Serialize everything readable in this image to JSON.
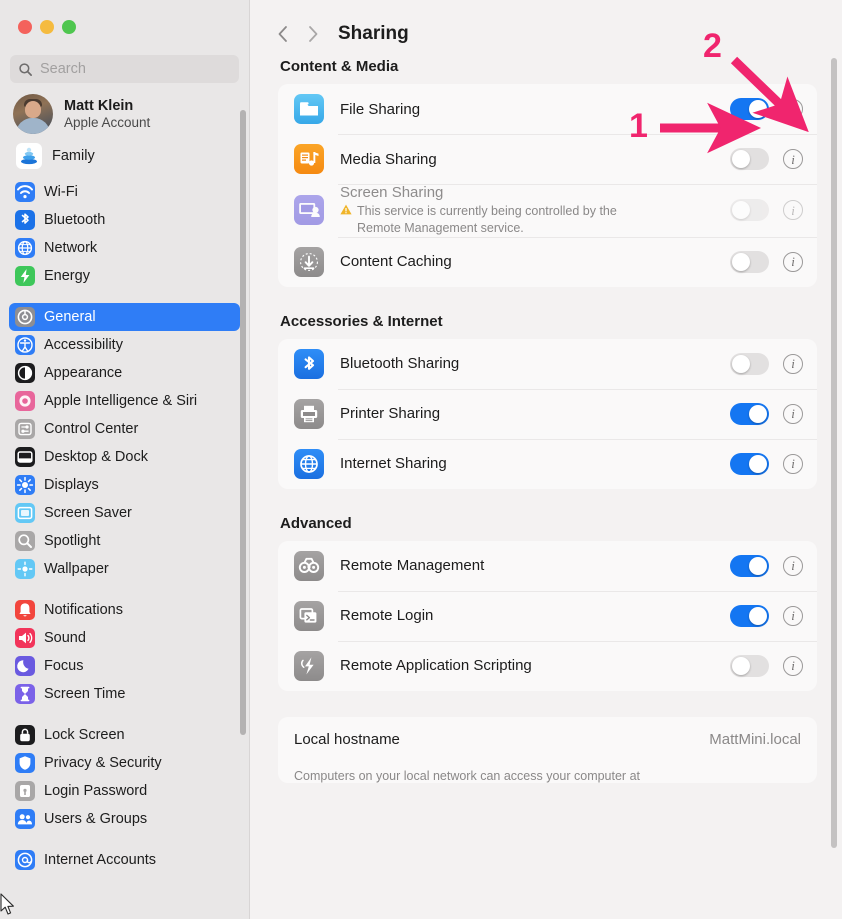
{
  "window": {
    "traffic_lights": [
      "close",
      "minimize",
      "zoom"
    ],
    "colors": {
      "close": "#f4625c",
      "minimize": "#f5bb3f",
      "zoom": "#4fc64f"
    }
  },
  "sidebar": {
    "search": {
      "placeholder": "Search",
      "value": "",
      "icon": "search-icon"
    },
    "account": {
      "name": "Matt Klein",
      "subtitle": "Apple Account",
      "avatar": "user-avatar"
    },
    "family": {
      "label": "Family",
      "icon": "family-icon"
    },
    "groups": [
      {
        "items": [
          {
            "label": "Wi-Fi",
            "icon": "wifi-icon",
            "color": "#2f7df6",
            "selected": false
          },
          {
            "label": "Bluetooth",
            "icon": "bluetooth-icon",
            "color": "#1b72e8",
            "selected": false
          },
          {
            "label": "Network",
            "icon": "network-icon",
            "color": "#2f7df6",
            "selected": false
          },
          {
            "label": "Energy",
            "icon": "energy-icon",
            "color": "#3ec75a",
            "selected": false
          }
        ]
      },
      {
        "items": [
          {
            "label": "General",
            "icon": "gear-icon",
            "color": "#8e8e93",
            "selected": true
          },
          {
            "label": "Accessibility",
            "icon": "accessibility-icon",
            "color": "#2f7df6",
            "selected": false
          },
          {
            "label": "Appearance",
            "icon": "appearance-icon",
            "color": "#1c1c1e",
            "selected": false
          },
          {
            "label": "Apple Intelligence & Siri",
            "icon": "siri-icon",
            "color": "#e8669b",
            "selected": false
          },
          {
            "label": "Control Center",
            "icon": "control-center-icon",
            "color": "#a9a7a7",
            "selected": false
          },
          {
            "label": "Desktop & Dock",
            "icon": "desktop-dock-icon",
            "color": "#1c1c1e",
            "selected": false
          },
          {
            "label": "Displays",
            "icon": "displays-icon",
            "color": "#2f7df6",
            "selected": false
          },
          {
            "label": "Screen Saver",
            "icon": "screen-saver-icon",
            "color": "#63c8f5",
            "selected": false
          },
          {
            "label": "Spotlight",
            "icon": "spotlight-icon",
            "color": "#a9a7a7",
            "selected": false
          },
          {
            "label": "Wallpaper",
            "icon": "wallpaper-icon",
            "color": "#63c8f5",
            "selected": false
          }
        ]
      },
      {
        "items": [
          {
            "label": "Notifications",
            "icon": "notifications-icon",
            "color": "#f2453d",
            "selected": false
          },
          {
            "label": "Sound",
            "icon": "sound-icon",
            "color": "#f2345a",
            "selected": false
          },
          {
            "label": "Focus",
            "icon": "focus-icon",
            "color": "#6a5ae0",
            "selected": false
          },
          {
            "label": "Screen Time",
            "icon": "screen-time-icon",
            "color": "#7b62e8",
            "selected": false
          }
        ]
      },
      {
        "items": [
          {
            "label": "Lock Screen",
            "icon": "lock-screen-icon",
            "color": "#1c1c1e",
            "selected": false
          },
          {
            "label": "Privacy & Security",
            "icon": "privacy-security-icon",
            "color": "#2f7df6",
            "selected": false
          },
          {
            "label": "Login Password",
            "icon": "login-password-icon",
            "color": "#a9a7a7",
            "selected": false
          },
          {
            "label": "Users & Groups",
            "icon": "users-groups-icon",
            "color": "#2f7df6",
            "selected": false
          }
        ]
      },
      {
        "items": [
          {
            "label": "Internet Accounts",
            "icon": "internet-accounts-icon",
            "color": "#2f7df6",
            "selected": false
          }
        ]
      }
    ]
  },
  "main": {
    "back_icon": "chevron-left-icon",
    "forward_icon": "chevron-right-icon",
    "title": "Sharing",
    "sections": [
      {
        "title": "Content & Media",
        "rows": [
          {
            "label": "File Sharing",
            "icon": "file-sharing-icon",
            "toggle": "on",
            "disabled": false,
            "info": "info-icon",
            "note": ""
          },
          {
            "label": "Media Sharing",
            "icon": "media-sharing-icon",
            "toggle": "off",
            "disabled": false,
            "info": "info-icon",
            "note": ""
          },
          {
            "label": "Screen Sharing",
            "icon": "screen-sharing-icon",
            "toggle": "off",
            "disabled": true,
            "info": "info-icon",
            "note": "This service is currently being controlled by the Remote Management service.",
            "warning_icon": "warning-triangle-icon"
          },
          {
            "label": "Content Caching",
            "icon": "content-caching-icon",
            "toggle": "off",
            "disabled": false,
            "info": "info-icon",
            "note": ""
          }
        ]
      },
      {
        "title": "Accessories & Internet",
        "rows": [
          {
            "label": "Bluetooth Sharing",
            "icon": "bluetooth-sharing-icon",
            "toggle": "off",
            "disabled": false,
            "info": "info-icon",
            "note": ""
          },
          {
            "label": "Printer Sharing",
            "icon": "printer-sharing-icon",
            "toggle": "on",
            "disabled": false,
            "info": "info-icon",
            "note": ""
          },
          {
            "label": "Internet Sharing",
            "icon": "internet-sharing-icon",
            "toggle": "on",
            "disabled": false,
            "info": "info-icon",
            "note": ""
          }
        ]
      },
      {
        "title": "Advanced",
        "rows": [
          {
            "label": "Remote Management",
            "icon": "remote-management-icon",
            "toggle": "on",
            "disabled": false,
            "info": "info-icon",
            "note": ""
          },
          {
            "label": "Remote Login",
            "icon": "remote-login-icon",
            "toggle": "on",
            "disabled": false,
            "info": "info-icon",
            "note": ""
          },
          {
            "label": "Remote Application Scripting",
            "icon": "remote-scripting-icon",
            "toggle": "off",
            "disabled": false,
            "info": "info-icon",
            "note": ""
          }
        ]
      }
    ],
    "hostname": {
      "label": "Local hostname",
      "value": "MattMini.local",
      "description": "Computers on your local network can access your computer at"
    }
  },
  "annotations": {
    "color": "#f0256e",
    "items": [
      {
        "number": "1",
        "points_to": "file-sharing-toggle"
      },
      {
        "number": "2",
        "points_to": "file-sharing-info-button"
      }
    ]
  }
}
